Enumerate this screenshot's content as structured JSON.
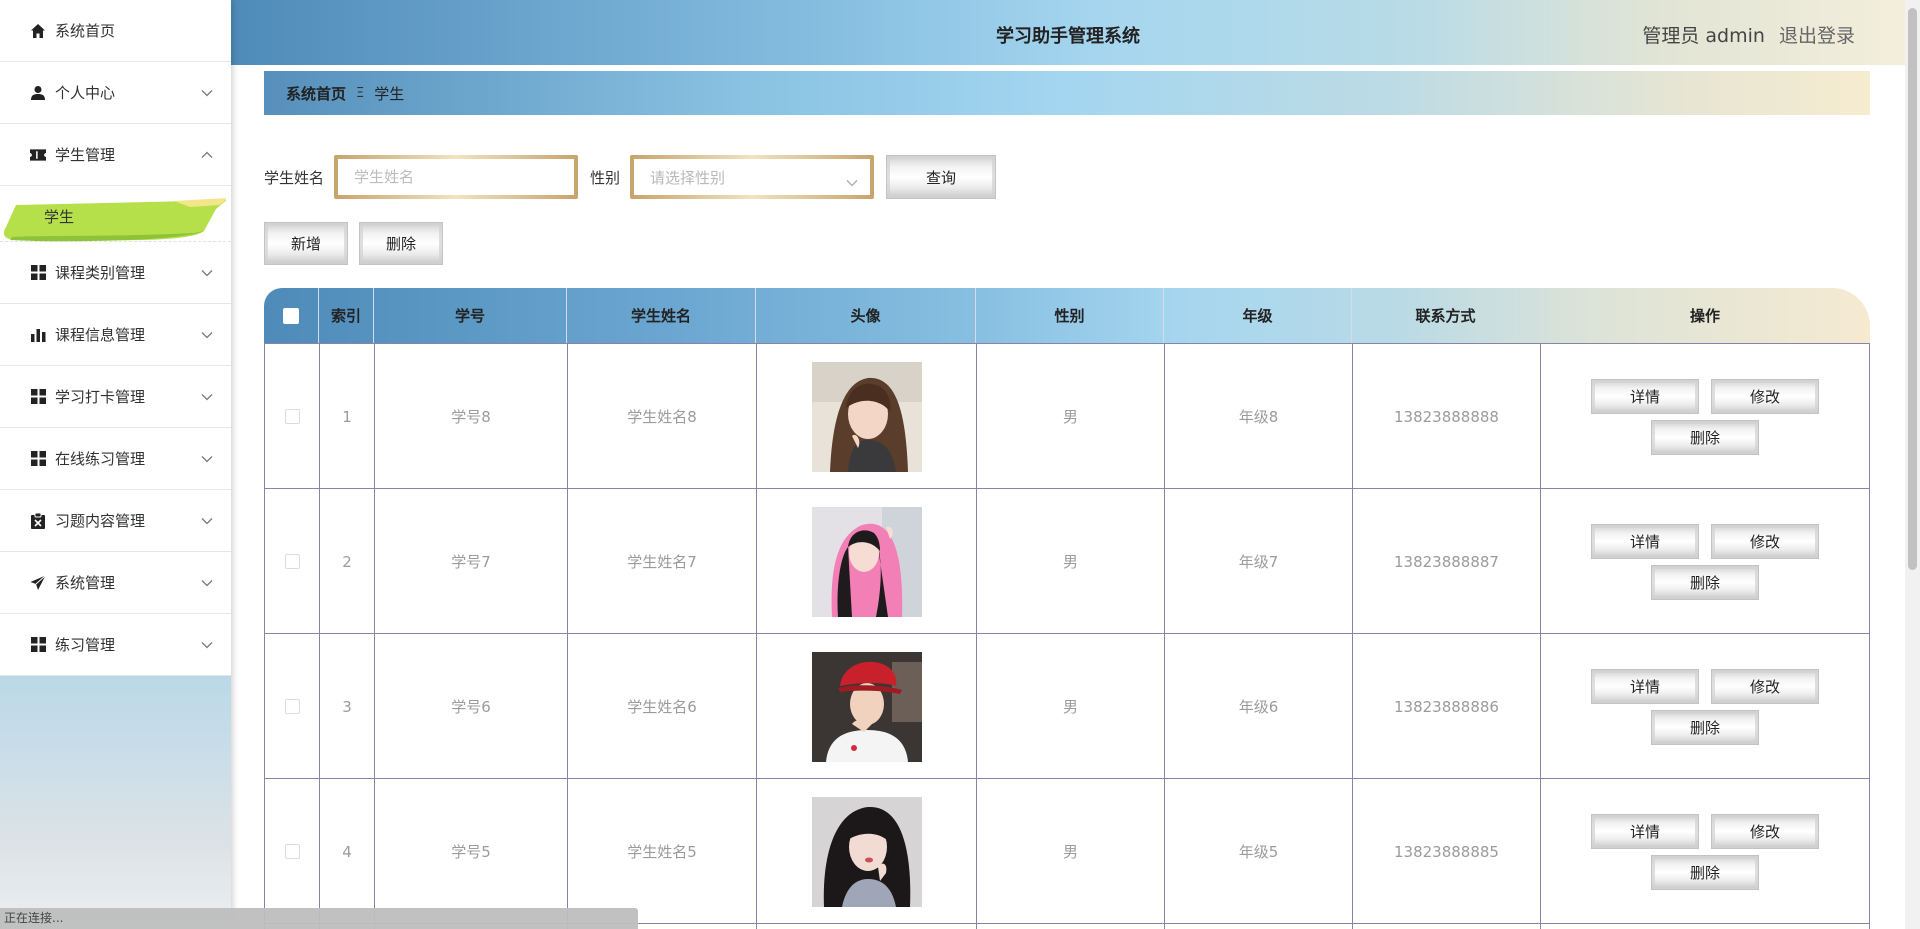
{
  "app": {
    "title": "学习助手管理系统"
  },
  "header": {
    "admin_label": "管理员 admin",
    "logout_label": "退出登录"
  },
  "sidebar": {
    "items": [
      {
        "label": "系统首页",
        "icon": "home-icon",
        "expandable": false
      },
      {
        "label": "个人中心",
        "icon": "user-icon",
        "expandable": true,
        "expanded": false
      },
      {
        "label": "学生管理",
        "icon": "ticket-icon",
        "expandable": true,
        "expanded": true,
        "children": [
          {
            "label": "学生",
            "active": true
          }
        ]
      },
      {
        "label": "课程类别管理",
        "icon": "grid-icon",
        "expandable": true,
        "expanded": false
      },
      {
        "label": "课程信息管理",
        "icon": "bar-chart-icon",
        "expandable": true,
        "expanded": false
      },
      {
        "label": "学习打卡管理",
        "icon": "grid-icon",
        "expandable": true,
        "expanded": false
      },
      {
        "label": "在线练习管理",
        "icon": "grid-icon",
        "expandable": true,
        "expanded": false
      },
      {
        "label": "习题内容管理",
        "icon": "clipboard-icon",
        "expandable": true,
        "expanded": false
      },
      {
        "label": "系统管理",
        "icon": "send-icon",
        "expandable": true,
        "expanded": false
      },
      {
        "label": "练习管理",
        "icon": "grid-icon",
        "expandable": true,
        "expanded": false
      }
    ]
  },
  "breadcrumb": {
    "home": "系统首页",
    "separator": "Ξ",
    "current": "学生"
  },
  "search": {
    "name_label": "学生姓名",
    "name_placeholder": "学生姓名",
    "gender_label": "性别",
    "gender_placeholder": "请选择性别",
    "query_label": "查询"
  },
  "actions": {
    "add_label": "新增",
    "delete_label": "删除"
  },
  "table": {
    "columns": [
      "索引",
      "学号",
      "学生姓名",
      "头像",
      "性别",
      "年级",
      "联系方式",
      "操作"
    ],
    "row_actions": {
      "detail": "详情",
      "edit": "修改",
      "delete": "删除"
    },
    "rows": [
      {
        "index": "1",
        "student_no": "学号8",
        "name": "学生姓名8",
        "gender": "男",
        "grade": "年级8",
        "phone": "13823888888"
      },
      {
        "index": "2",
        "student_no": "学号7",
        "name": "学生姓名7",
        "gender": "男",
        "grade": "年级7",
        "phone": "13823888887"
      },
      {
        "index": "3",
        "student_no": "学号6",
        "name": "学生姓名6",
        "gender": "男",
        "grade": "年级6",
        "phone": "13823888886"
      },
      {
        "index": "4",
        "student_no": "学号5",
        "name": "学生姓名5",
        "gender": "男",
        "grade": "年级5",
        "phone": "13823888885"
      }
    ]
  },
  "status": {
    "text": "正在连接..."
  },
  "colors": {
    "header_start": "#4f8bb9",
    "header_end": "#f3eedc",
    "active_submenu": "#b5e04a",
    "row_border": "#8883a8"
  }
}
